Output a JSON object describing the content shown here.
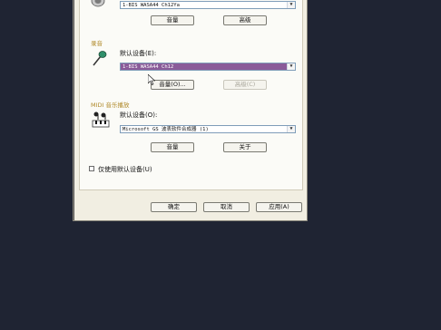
{
  "playback": {
    "device_value": "1-BIS WASA44 Ch12Ya",
    "volume_button": "音量",
    "advanced_button": "高级"
  },
  "recording": {
    "group_title": "录音",
    "default_device_label": "默认设备(E):",
    "device_value": "1-BIS WASA44 Ch12",
    "volume_button": "音量(O)...",
    "advanced_button": "高级(C)"
  },
  "midi": {
    "group_title": "MIDI 音乐播放",
    "default_device_label": "默认设备(O):",
    "device_value": "Microsoft GS 波表软件合成器 (1)",
    "volume_button": "音量",
    "about_button": "关于"
  },
  "only_default_label": "仅使用默认设备(U)",
  "footer": {
    "ok": "确定",
    "cancel": "取消",
    "apply": "应用(A)"
  },
  "colors": {
    "background": "#1f2433",
    "selection": "#8a5b99",
    "group_title": "#b08a2a"
  }
}
